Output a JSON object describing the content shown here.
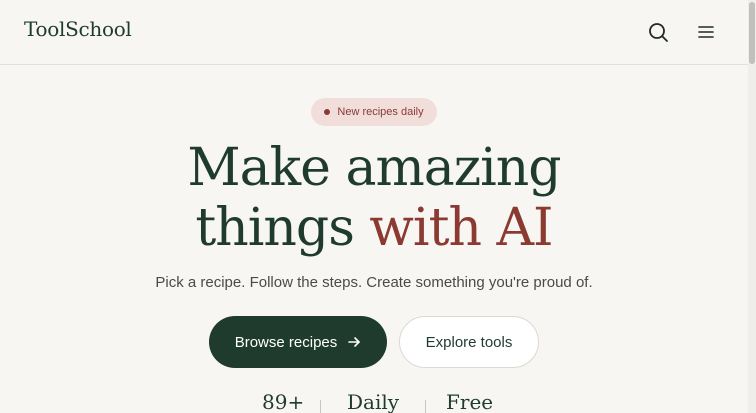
{
  "header": {
    "logo": "ToolSchool",
    "icons": {
      "search": "search-icon",
      "menu": "menu-icon"
    }
  },
  "hero": {
    "badge": "New recipes daily",
    "headline_line1": "Make amazing",
    "headline_line2_prefix": "things",
    "headline_line2_accent": "with AI",
    "subtitle": "Pick a recipe. Follow the steps. Create something you're proud of.",
    "primary_button": "Browse recipes",
    "secondary_button": "Explore tools"
  },
  "stats": [
    {
      "value": "89+"
    },
    {
      "value": "Daily"
    },
    {
      "value": "Free"
    }
  ],
  "colors": {
    "brand_green": "#1f3b2e",
    "accent_red": "#8b3a32",
    "badge_bg": "#f1dedb",
    "page_bg": "#f8f6f3"
  }
}
